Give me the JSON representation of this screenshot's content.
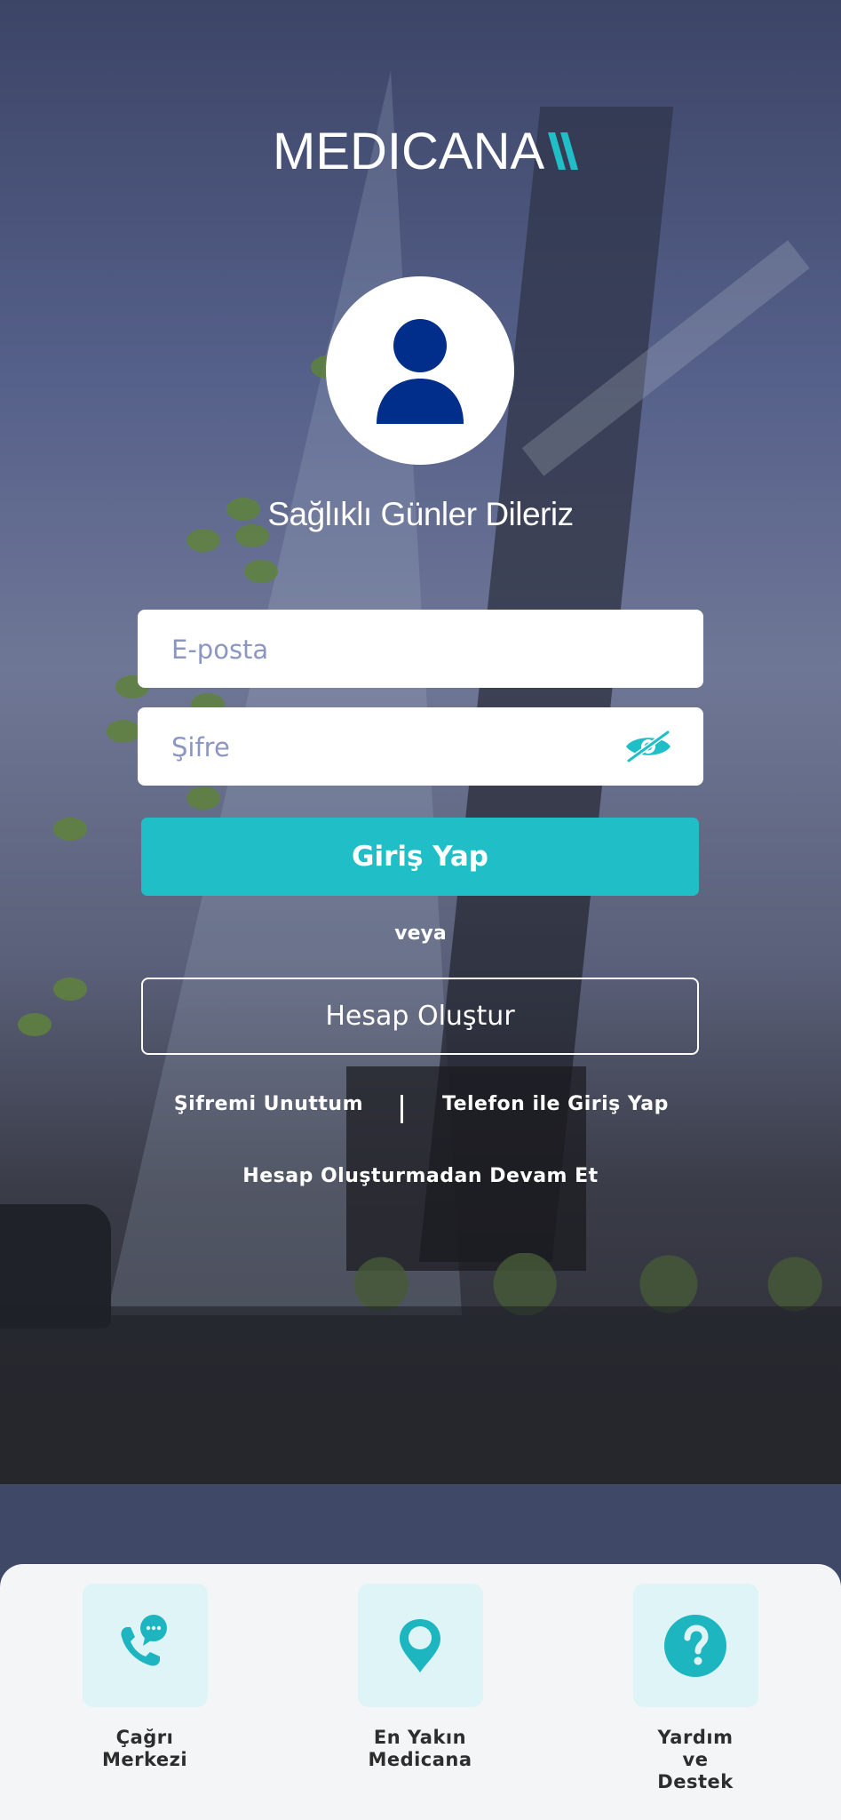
{
  "brand": {
    "logo_text": "MEDICANA",
    "accent": "#20bfc8",
    "navy": "#002e8a"
  },
  "greeting": "Sağlıklı Günler Dileriz",
  "form": {
    "email_placeholder": "E-posta",
    "password_placeholder": "Şifre",
    "password_toggle_icon": "eye-slash-icon",
    "login_label": "Giriş Yap",
    "or_label": "veya",
    "create_account_label": "Hesap Oluştur",
    "forgot_password_label": "Şifremi Unuttum",
    "phone_login_label": "Telefon ile Giriş Yap",
    "guest_label": "Hesap Oluşturmadan Devam Et"
  },
  "quick_actions": [
    {
      "icon": "phone-chat-icon",
      "label_line1": "Çağrı",
      "label_line2": "Merkezi",
      "label_line3": ""
    },
    {
      "icon": "location-pin-icon",
      "label_line1": "En Yakın",
      "label_line2": "Medicana",
      "label_line3": ""
    },
    {
      "icon": "question-mark-icon",
      "label_line1": "Yardım",
      "label_line2": "ve",
      "label_line3": "Destek"
    }
  ]
}
